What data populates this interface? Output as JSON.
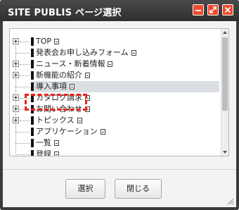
{
  "window": {
    "title": "SITE PUBLIS ページ選択",
    "controls": [
      "minimize-icon",
      "maximize-icon",
      "close-icon"
    ],
    "accent_color": "#f04a2f",
    "highlight_color": "#e8241a"
  },
  "tree": {
    "items": [
      {
        "label": "TOP",
        "expandable": true,
        "selected": false
      },
      {
        "label": "発表会お申し込みフォーム",
        "expandable": false,
        "selected": false
      },
      {
        "label": "ニュース・新着情報",
        "expandable": true,
        "selected": false
      },
      {
        "label": "新機能の紹介",
        "expandable": true,
        "selected": false
      },
      {
        "label": "導入事項",
        "expandable": false,
        "selected": true
      },
      {
        "label": "カタログ請求",
        "expandable": true,
        "selected": false
      },
      {
        "label": "お問い合わせ",
        "expandable": true,
        "selected": false
      },
      {
        "label": "トピックス",
        "expandable": true,
        "selected": false
      },
      {
        "label": "アプリケーション",
        "expandable": false,
        "selected": false
      },
      {
        "label": "一覧",
        "expandable": false,
        "selected": false
      },
      {
        "label": "登録",
        "expandable": false,
        "selected": false
      }
    ]
  },
  "buttons": {
    "select_label": "選択",
    "close_label": "閉じる"
  }
}
